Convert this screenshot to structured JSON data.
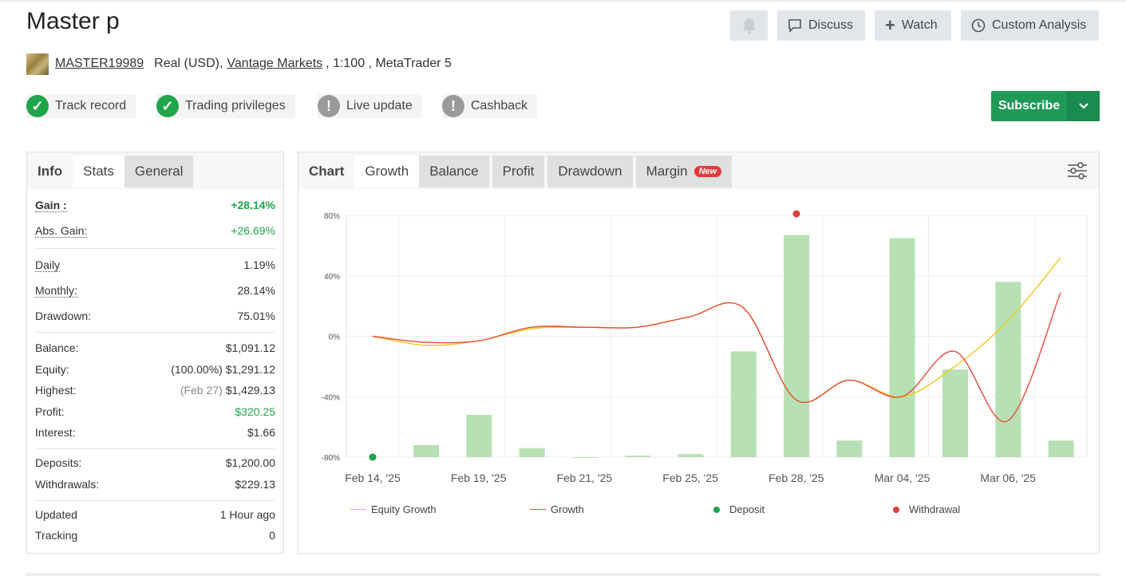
{
  "header": {
    "title": "Master p",
    "buttons": {
      "discuss": "Discuss",
      "watch": "Watch",
      "custom_analysis": "Custom Analysis"
    }
  },
  "account": {
    "username": "MASTER19989",
    "type": "Real (USD),",
    "broker": "Vantage Markets",
    "details": ", 1:100 , MetaTrader 5"
  },
  "badges": [
    {
      "label": "Track record",
      "status": "ok"
    },
    {
      "label": "Trading privileges",
      "status": "ok"
    },
    {
      "label": "Live update",
      "status": "warn"
    },
    {
      "label": "Cashback",
      "status": "warn"
    }
  ],
  "subscribe_label": "Subscribe",
  "left_tabs": [
    "Info",
    "Stats",
    "General"
  ],
  "stats": {
    "gain_label": "Gain :",
    "gain": "+28.14%",
    "abs_gain_label": "Abs. Gain:",
    "abs_gain": "+26.69%",
    "daily_label": "Daily",
    "daily": "1.19%",
    "monthly_label": "Monthly:",
    "monthly": "28.14%",
    "drawdown_label": "Drawdown:",
    "drawdown": "75.01%",
    "balance_label": "Balance:",
    "balance": "$1,091.12",
    "equity_label": "Equity:",
    "equity_pct": "(100.00%)",
    "equity": "$1,291.12",
    "highest_label": "Highest:",
    "highest_date": "(Feb 27)",
    "highest": "$1,429.13",
    "profit_label": "Profit:",
    "profit": "$320.25",
    "interest_label": "Interest:",
    "interest": "$1.66",
    "deposits_label": "Deposits:",
    "deposits": "$1,200.00",
    "withdrawals_label": "Withdrawals:",
    "withdrawals": "$229.13",
    "updated_label": "Updated",
    "updated": "1 Hour ago",
    "tracking_label": "Tracking",
    "tracking": "0"
  },
  "chart_tabs": {
    "chart": "Chart",
    "growth": "Growth",
    "balance": "Balance",
    "profit": "Profit",
    "drawdown": "Drawdown",
    "margin": "Margin",
    "new_badge": "New"
  },
  "chart_data": {
    "type": "line",
    "categories": [
      "Feb 14, '25",
      "Feb 19, '25",
      "Feb 21, '25",
      "Feb 25, '25",
      "Feb 28, '25",
      "Mar 04, '25",
      "Mar 06, '25"
    ],
    "ylim": [
      -80,
      80
    ],
    "yticks": [
      "80%",
      "40%",
      "0%",
      "-40%",
      "-80%"
    ],
    "grid": true,
    "bars": [
      -72,
      -52,
      -74,
      -80,
      -79,
      -78,
      -10,
      67,
      -69,
      65,
      -22,
      36,
      -69
    ],
    "series": [
      {
        "name": "Equity Growth",
        "color": "#f2c619",
        "values": [
          0,
          -6,
          -3,
          5,
          6,
          6,
          13,
          19,
          -42,
          -29,
          -40,
          -20,
          10,
          52
        ]
      },
      {
        "name": "Growth",
        "color": "#e74c3c",
        "values": [
          0,
          -4,
          -3,
          6,
          6,
          6,
          13,
          19,
          -42,
          -29,
          -40,
          -10,
          -56,
          29
        ]
      }
    ],
    "deposits": [
      0
    ],
    "withdrawals": [
      80
    ],
    "legend": [
      "Equity Growth",
      "Growth",
      "Deposit",
      "Withdrawal"
    ],
    "legend_position": "bottom",
    "colors": {
      "bar": "#b7e0b5",
      "deposit": "#18a24a",
      "withdrawal": "#e03e3e"
    }
  }
}
